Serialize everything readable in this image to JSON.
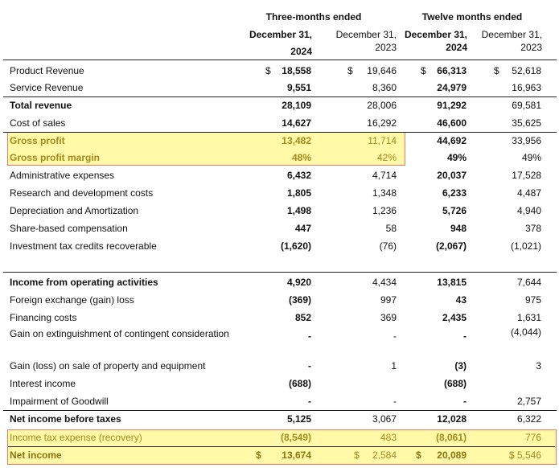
{
  "header": {
    "group1": "Three-months ended",
    "group2": "Twelve months ended",
    "col1_line1": "December 31,",
    "col1_line2": "2024",
    "col2_line1": "December 31,",
    "col2_line2": "2023",
    "col3_line1": "December 31,",
    "col3_line2": "2024",
    "col4_line1": "December 31,",
    "col4_line2": "2023"
  },
  "rows": [
    {
      "label": "Product Revenue",
      "cur1": "$",
      "v1": "18,558",
      "cur2": "$",
      "v2": "19,646",
      "cur3": "$",
      "v3": "66,313",
      "cur4": "$",
      "v4": "52,618"
    },
    {
      "label": "Service Revenue",
      "v1": "9,551",
      "v2": "8,360",
      "v3": "24,979",
      "v4": "16,963"
    },
    {
      "label": "Total revenue",
      "v1": "28,109",
      "v2": "28,006",
      "v3": "91,292",
      "v4": "69,581"
    },
    {
      "label": "Cost of sales",
      "v1": "14,627",
      "v2": "16,292",
      "v3": "46,600",
      "v4": "35,625"
    },
    {
      "label": "Gross profit",
      "v1": "13,482",
      "v2": "11,714",
      "v3": "44,692",
      "v4": "33,956"
    },
    {
      "label": "Gross profit margin",
      "v1": "48%",
      "v2": "42%",
      "v3": "49%",
      "v4": "49%"
    },
    {
      "label": "Administrative expenses",
      "v1": "6,432",
      "v2": "4,714",
      "v3": "20,037",
      "v4": "17,528"
    },
    {
      "label": "Research and development costs",
      "v1": "1,805",
      "v2": "1,348",
      "v3": "6,233",
      "v4": "4,487"
    },
    {
      "label": "Depreciation and Amortization",
      "v1": "1,498",
      "v2": "1,236",
      "v3": "5,726",
      "v4": "4,940"
    },
    {
      "label": "Share-based compensation",
      "v1": "447",
      "v2": "58",
      "v3": "948",
      "v4": "378"
    },
    {
      "label": "Investment tax credits recoverable",
      "v1": "(1,620)",
      "v2": "(76)",
      "v3": "(2,067)",
      "v4": "(1,021)"
    },
    {
      "label": "Income from operating activities",
      "v1": "4,920",
      "v2": "4,434",
      "v3": "13,815",
      "v4": "7,644"
    },
    {
      "label": "Foreign exchange (gain) loss",
      "v1": "(369)",
      "v2": "997",
      "v3": "43",
      "v4": "975"
    },
    {
      "label": "Financing costs",
      "v1": "852",
      "v2": "369",
      "v3": "2,435",
      "v4": "1,631"
    },
    {
      "label": "Gain on extinguishment of contingent consideration",
      "v1": "-",
      "v2": "-",
      "v3": "-",
      "v4": "(4,044)"
    },
    {
      "label": "Gain (loss) on sale of property and equipment",
      "v1": "-",
      "v2": "1",
      "v3": "(3)",
      "v4": "3"
    },
    {
      "label": "Interest income",
      "v1": "(688)",
      "v2": "",
      "v3": "(688)",
      "v4": ""
    },
    {
      "label": "Impairment of Goodwill",
      "v1": "-",
      "v2": "-",
      "v3": "-",
      "v4": "2,757"
    },
    {
      "label": "Net income before taxes",
      "v1": "5,125",
      "v2": "3,067",
      "v3": "12,028",
      "v4": "6,322"
    },
    {
      "label": "Income tax expense (recovery)",
      "v1": "(8,549)",
      "v2": "483",
      "v3": "(8,061)",
      "v4": "776"
    },
    {
      "label": "Net income",
      "cur1": "$",
      "v1": "13,674",
      "cur2": "$",
      "v2": "2,584",
      "cur3": "$",
      "v3": "20,089",
      "v4": "$ 5,546"
    }
  ]
}
